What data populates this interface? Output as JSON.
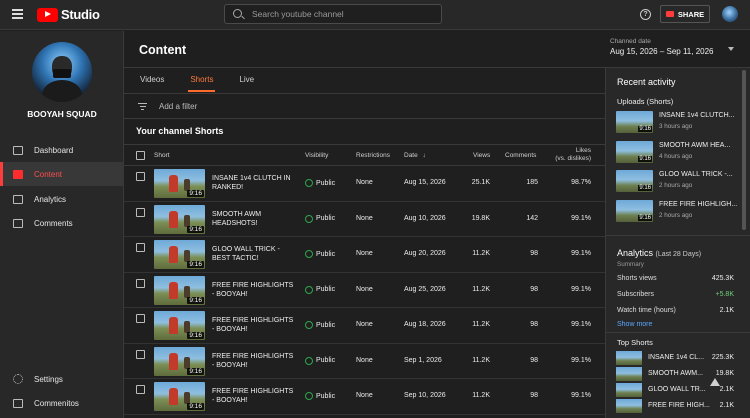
{
  "topbar": {
    "logo_text": "Studio",
    "search_placeholder": "Search youtube channel",
    "help_glyph": "?",
    "share_label": "SHARE"
  },
  "sidebar": {
    "channel_name": "BOOYAH SQUAD",
    "items": [
      {
        "label": "Dashboard",
        "icon": "dashboard-icon",
        "active": false
      },
      {
        "label": "Content",
        "icon": "content-icon",
        "active": true
      },
      {
        "label": "Analytics",
        "icon": "analytics-icon",
        "active": false
      },
      {
        "label": "Comments",
        "icon": "comments-icon",
        "active": false
      },
      {
        "label": "Settings",
        "icon": "gear-icon",
        "active": false
      },
      {
        "label": "Commenitos",
        "icon": "feedback-icon",
        "active": false
      }
    ]
  },
  "main": {
    "title": "Content",
    "tabs": [
      {
        "label": "Videos",
        "active": false
      },
      {
        "label": "Shorts",
        "active": true
      },
      {
        "label": "Live",
        "active": false
      }
    ],
    "filter_label": "Add a filter",
    "section_title": "Your channel Shorts",
    "columns": {
      "short": "Short",
      "visibility": "Visibility",
      "restrictions": "Restrictions",
      "date": "Date",
      "views": "Views",
      "comments": "Comments",
      "likes_line1": "Likes",
      "likes_line2": "(vs. dislikes)"
    },
    "rows": [
      {
        "title": "INSANE 1v4 CLUTCH IN RANKED!",
        "duration": "9:16",
        "visibility": "Public",
        "restrictions": "None",
        "date": "Aug 15, 2026",
        "views": "25.1K",
        "comments": "185",
        "likes": "98.7%"
      },
      {
        "title": "SMOOTH AWM HEADSHOTS!",
        "duration": "9:16",
        "visibility": "Public",
        "restrictions": "None",
        "date": "Aug 10, 2026",
        "views": "19.8K",
        "comments": "142",
        "likes": "99.1%"
      },
      {
        "title": "GLOO WALL TRICK - BEST TACTIC!",
        "duration": "9:16",
        "visibility": "Public",
        "restrictions": "None",
        "date": "Aug 20, 2026",
        "views": "11.2K",
        "comments": "98",
        "likes": "99.1%"
      },
      {
        "title": "FREE FIRE HIGHLIGHTS - BOOYAH!",
        "duration": "9:16",
        "visibility": "Public",
        "restrictions": "None",
        "date": "Aug 25, 2026",
        "views": "11.2K",
        "comments": "98",
        "likes": "99.1%"
      },
      {
        "title": "FREE FIRE HIGHLIGHTS - BOOYAH!",
        "duration": "9:16",
        "visibility": "Public",
        "restrictions": "None",
        "date": "Aug 18, 2026",
        "views": "11.2K",
        "comments": "98",
        "likes": "99.1%"
      },
      {
        "title": "FREE FIRE HIGHLIGHTS - BOOYAH!",
        "duration": "9:16",
        "visibility": "Public",
        "restrictions": "None",
        "date": "Sep 1, 2026",
        "views": "11.2K",
        "comments": "98",
        "likes": "99.1%"
      },
      {
        "title": "FREE FIRE HIGHLIGHTS - BOOYAH!",
        "duration": "9:16",
        "visibility": "Public",
        "restrictions": "None",
        "date": "Sep 10, 2026",
        "views": "11.2K",
        "comments": "98",
        "likes": "99.1%"
      }
    ]
  },
  "date_selector": {
    "label": "Channed date",
    "value": "Aug 15, 2026 – Sep 11, 2026"
  },
  "right_panel": {
    "recent_title": "Recent activity",
    "uploads_title": "Uploads (Shorts)",
    "uploads": [
      {
        "name": "INSANE 1v4 CLUTCH...",
        "age": "3 hours ago",
        "duration": "9:16"
      },
      {
        "name": "SMOOTH AWM HEA...",
        "age": "4 hours ago",
        "duration": "9:16"
      },
      {
        "name": "GLOO WALL TRICK -...",
        "age": "2 hours ago",
        "duration": "9:16"
      },
      {
        "name": "FREE FIRE HIGHLIGH...",
        "age": "2 hours ago",
        "duration": "9:16"
      }
    ],
    "analytics_title": "Analytics",
    "analytics_period": "(Last 28 Days)",
    "summary_label": "Summary",
    "stats": [
      {
        "label": "Shorts views",
        "value": "425.3K",
        "positive": false
      },
      {
        "label": "Subscribers",
        "value": "+5.8K",
        "positive": true
      },
      {
        "label": "Watch time (hours)",
        "value": "2.1K",
        "positive": false
      }
    ],
    "show_more": "Show more",
    "top_shorts_title": "Top Shorts",
    "top_shorts": [
      {
        "name": "INSANE 1v4 CL...",
        "value": "225.3K"
      },
      {
        "name": "SMOOTH AWM...",
        "value": "19.8K"
      },
      {
        "name": "GLOO WALL TR...",
        "value": "2.1K"
      },
      {
        "name": "FREE FIRE HIGH...",
        "value": "2.1K"
      }
    ]
  },
  "colors": {
    "brand_red": "#ff0000",
    "tab_accent": "#ff6a2d",
    "public_green": "#2ea64e",
    "link_blue": "#5aa9ff"
  }
}
